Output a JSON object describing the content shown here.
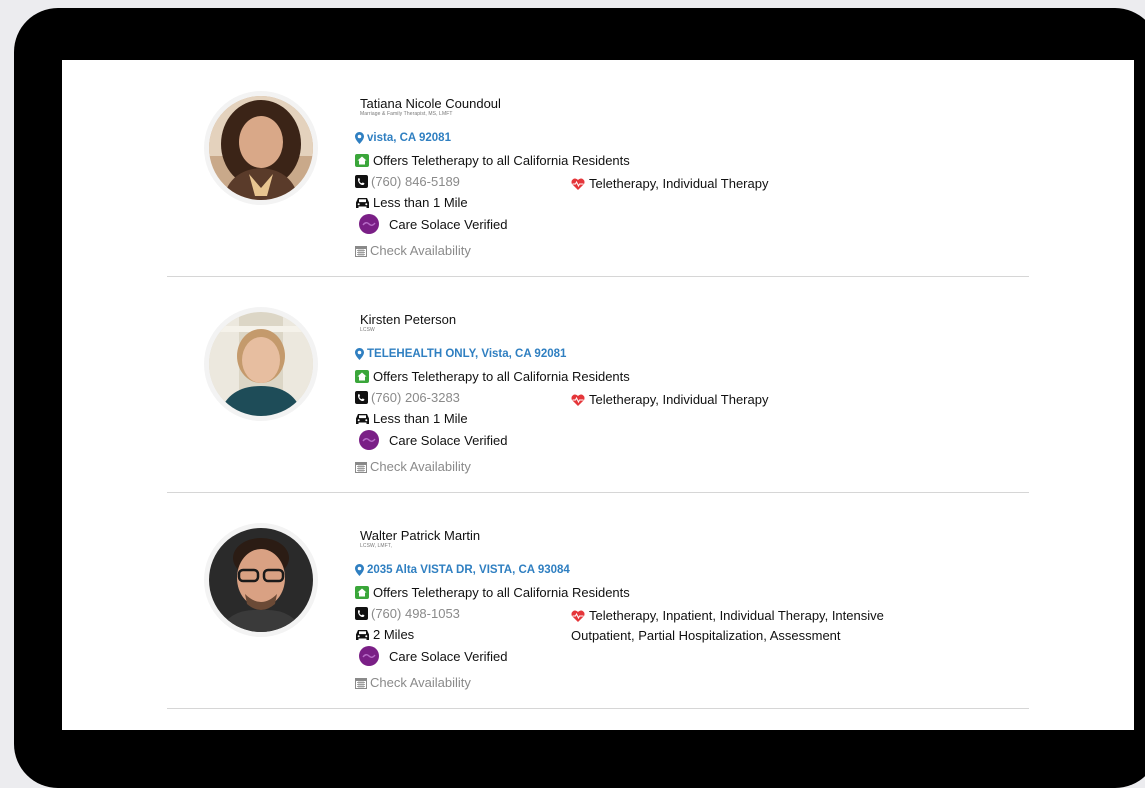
{
  "icons": {
    "location": "map-marker-icon",
    "telehealth": "home-icon",
    "phone": "phone-icon",
    "distance": "car-icon",
    "verified": "care-solace-logo-icon",
    "services": "heartbeat-icon",
    "calendar": "calendar-icon"
  },
  "colors": {
    "link": "#2f7fc1",
    "home": "#3aa63a",
    "heart": "#e5363a",
    "verified": "#7a1f86",
    "muted": "#8a8a8a"
  },
  "providers": [
    {
      "name": "Tatiana Nicole Coundoul",
      "credentials": "Marriage & Family Therapist, MS, LMFT",
      "location": "vista, CA 92081",
      "telehealth": "Offers Teletherapy to all California Residents",
      "phone": "(760) 846-5189",
      "distance": "Less than 1 Mile",
      "verified": "Care Solace Verified",
      "services": "Teletherapy, Individual Therapy",
      "availability": "Check Availability"
    },
    {
      "name": "Kirsten Peterson",
      "credentials": "LCSW",
      "location": "TELEHEALTH ONLY, Vista, CA 92081",
      "telehealth": "Offers Teletherapy to all California Residents",
      "phone": "(760) 206-3283",
      "distance": "Less than 1 Mile",
      "verified": "Care Solace Verified",
      "services": "Teletherapy, Individual Therapy",
      "availability": "Check Availability"
    },
    {
      "name": "Walter Patrick Martin",
      "credentials": "LCSW, LMFT,",
      "location": "2035 Alta VISTA DR, VISTA, CA 93084",
      "telehealth": "Offers Teletherapy to all California Residents",
      "phone": "(760) 498-1053",
      "distance": "2 Miles",
      "verified": "Care Solace Verified",
      "services": "Teletherapy, Inpatient, Individual Therapy, Intensive Outpatient, Partial Hospitalization, Assessment",
      "availability": "Check Availability"
    }
  ]
}
